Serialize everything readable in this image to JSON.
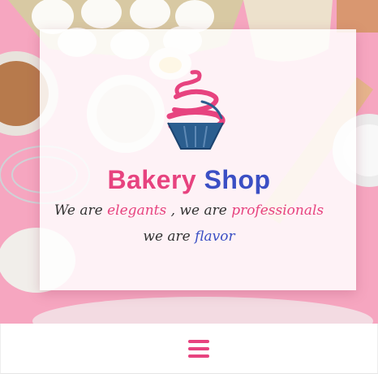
{
  "hero": {
    "title_word_1": "Bakery",
    "title_word_2": "Shop",
    "line1": {
      "part1": "We are",
      "part2": "elegants",
      "part3": ", we are",
      "part4": "professionals"
    },
    "line2": {
      "part1": "we are",
      "part2": "flavor"
    }
  },
  "navbar": {
    "menu_icon": "hamburger-menu-icon"
  },
  "colors": {
    "accent_pink": "#e7437f",
    "accent_blue": "#3b4fc4",
    "hero_background": "#f7a9c3"
  }
}
